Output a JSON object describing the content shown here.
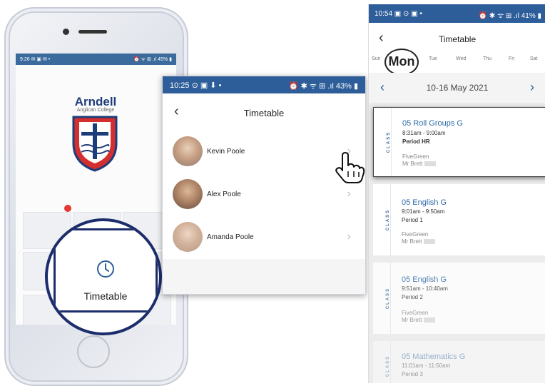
{
  "phone1": {
    "status_time": "9:26 ✉ ▣ ✉ •",
    "status_right": "⏰ ᯤ ⊞ .ıl 45% ▮",
    "school_name": "Arndell",
    "school_sub": "Anglican College",
    "magnified_tile_label": "Timetable",
    "icon": "clock-icon"
  },
  "popup": {
    "status_time": "10:25 ⊙ ▣ ⬇ •",
    "status_right": "⏰ ✱ ᯤ ⊞ .ıl 43% ▮",
    "title": "Timetable",
    "students": [
      {
        "name": "Kevin Poole"
      },
      {
        "name": "Alex Poole"
      },
      {
        "name": "Amanda Poole"
      }
    ]
  },
  "timetable": {
    "status_time": "10:54 ▣ ⊙ ▣ •",
    "status_right": "⏰ ✱ ᯤ ⊞ .ıl 41% ▮",
    "title": "Timetable",
    "days": [
      "Sun",
      "Mon",
      "Tue",
      "Wed",
      "Thu",
      "Fri",
      "Sat"
    ],
    "selected_day": "Mon",
    "week_range": "10-16 May 2021",
    "class_tag": "CLASS",
    "classes": [
      {
        "title": "05 Roll Groups G",
        "time": "8:31am - 9:00am",
        "period": "Period HR",
        "room": "FiveGreen",
        "teacher": "Mr Brett"
      },
      {
        "title": "05 English G",
        "time": "9:01am - 9:50am",
        "period": "Period 1",
        "room": "FiveGreen",
        "teacher": "Mr Brett"
      },
      {
        "title": "05 English G",
        "time": "9:51am - 10:40am",
        "period": "Period 2",
        "room": "FiveGreen",
        "teacher": "Mr Brett"
      },
      {
        "title": "05 Mathematics G",
        "time": "11:01am - 11:50am",
        "period": "Period 3",
        "room": "",
        "teacher": ""
      }
    ],
    "accent_color": "#2d5e9a"
  }
}
